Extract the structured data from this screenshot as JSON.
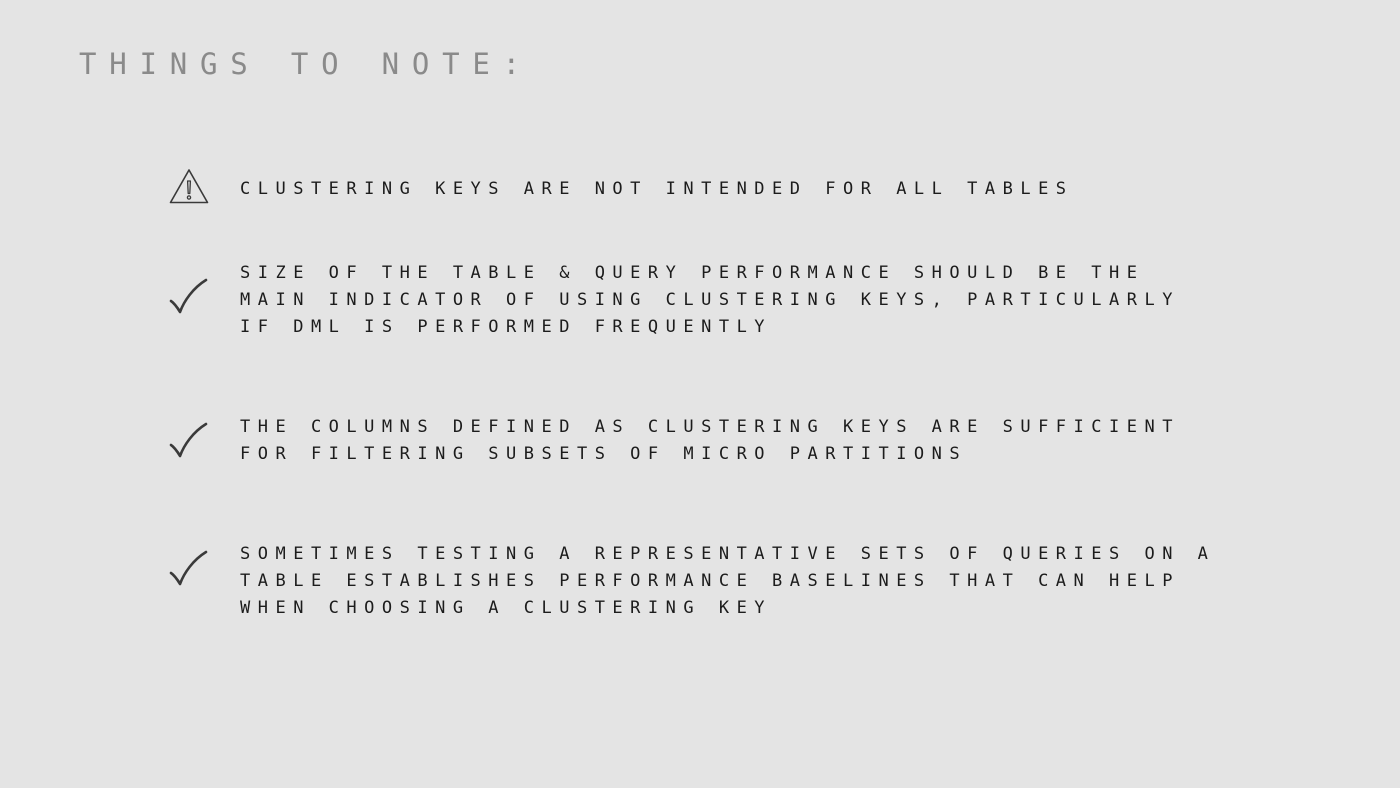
{
  "slide": {
    "title": "THINGS TO NOTE:",
    "notes": [
      {
        "icon": "warning-icon",
        "lines": [
          "CLUSTERING KEYS ARE NOT INTENDED FOR ALL TABLES"
        ]
      },
      {
        "icon": "checkmark-icon",
        "lines": [
          "SIZE OF THE TABLE & QUERY PERFORMANCE SHOULD BE THE",
          "MAIN INDICATOR OF USING CLUSTERING KEYS, PARTICULARLY",
          "IF DML IS PERFORMED FREQUENTLY"
        ]
      },
      {
        "icon": "checkmark-icon",
        "lines": [
          "THE COLUMNS DEFINED AS CLUSTERING KEYS ARE SUFFICIENT",
          "FOR FILTERING SUBSETS OF MICRO PARTITIONS"
        ]
      },
      {
        "icon": "checkmark-icon",
        "lines": [
          "SOMETIMES TESTING A REPRESENTATIVE SETS OF QUERIES ON A",
          "TABLE ESTABLISHES PERFORMANCE BASELINES THAT CAN HELP",
          "WHEN CHOOSING A CLUSTERING KEY"
        ]
      }
    ],
    "colors": {
      "background": "#e4e4e4",
      "title": "#8a8a8a",
      "text": "#1c1c1c",
      "icon": "#3a3a3a"
    }
  }
}
